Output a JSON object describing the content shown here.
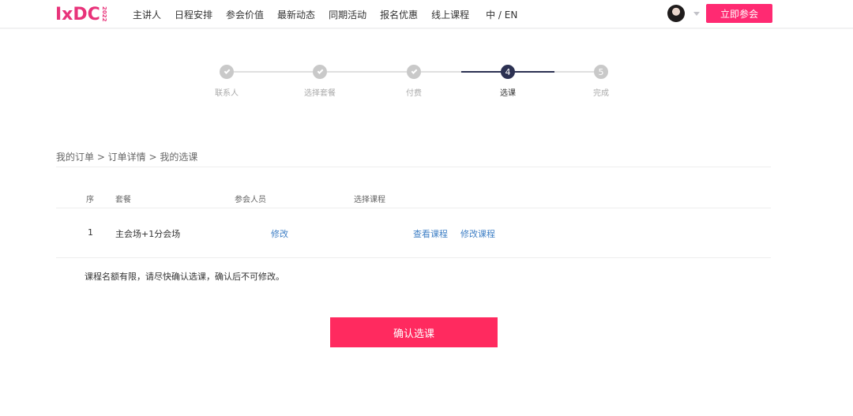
{
  "header": {
    "logo": "IxDC",
    "logo_year": "2022",
    "nav": [
      "主讲人",
      "日程安排",
      "参会价值",
      "最新动态",
      "同期活动",
      "报名优惠",
      "线上课程"
    ],
    "lang": "中 / EN",
    "cta": "立即参会",
    "brand_color": "#ff2a72"
  },
  "steps": [
    {
      "label": "联系人",
      "state": "done"
    },
    {
      "label": "选择套餐",
      "state": "done"
    },
    {
      "label": "付费",
      "state": "done"
    },
    {
      "label": "选课",
      "state": "current",
      "number": "4"
    },
    {
      "label": "完成",
      "state": "todo",
      "number": "5"
    }
  ],
  "breadcrumb": "我的订单 > 订单详情 > 我的选课",
  "table": {
    "headers": [
      "序",
      "套餐",
      "参会人员",
      "选择课程"
    ],
    "rows": [
      {
        "index": "1",
        "package": "主会场+1分会场",
        "attendee_edit": "修改",
        "view_course": "查看课程",
        "edit_course": "修改课程"
      }
    ]
  },
  "notice": "课程名额有限，请尽快确认选课，确认后不可修改。",
  "confirm_button": "确认选课"
}
